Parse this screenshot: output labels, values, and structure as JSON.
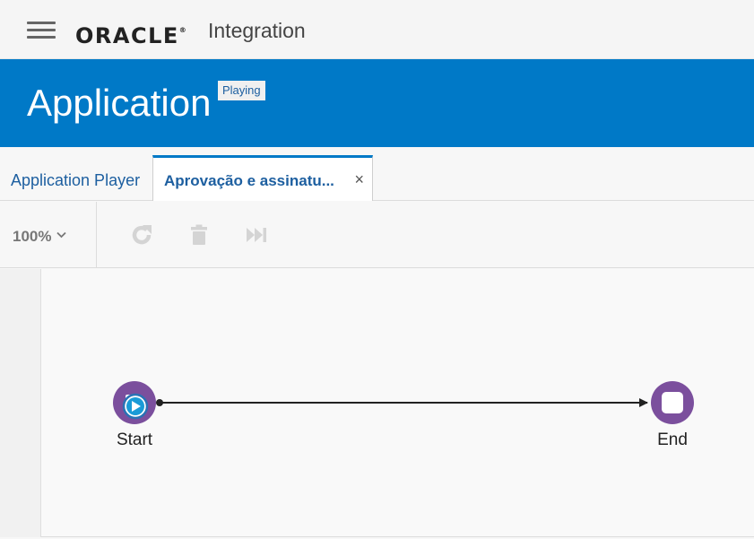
{
  "header": {
    "brand": "ORACLE",
    "product": "Integration",
    "menu_icon": "hamburger-menu-icon"
  },
  "banner": {
    "title": "Application",
    "status": "Playing",
    "color": "#0079c7"
  },
  "tabs": [
    {
      "label": "Application Player",
      "active": false
    },
    {
      "label": "Aprovação e assinatu...",
      "active": true,
      "close_glyph": "×"
    }
  ],
  "toolbar": {
    "zoom": "100%",
    "icons": [
      "refresh-icon",
      "delete-icon",
      "skip-forward-icon"
    ]
  },
  "process": {
    "start_label": "Start",
    "end_label": "End",
    "node_color": "#7b4f9d"
  }
}
